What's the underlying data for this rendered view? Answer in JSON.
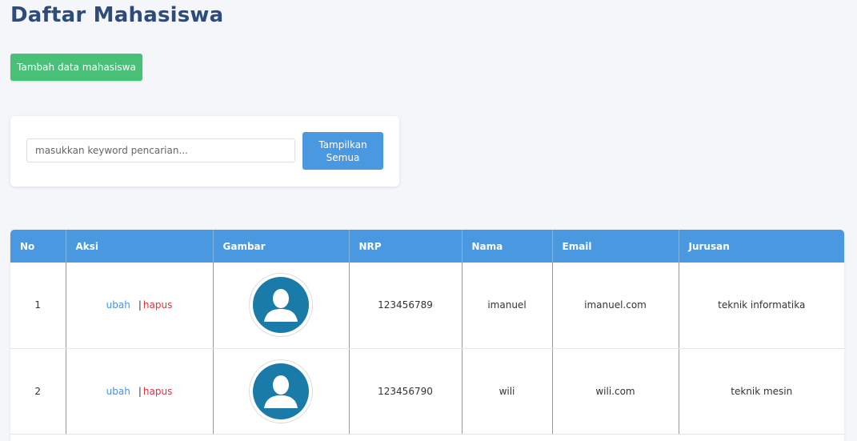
{
  "page": {
    "title": "Daftar Mahasiswa",
    "add_button_label": "Tambah data mahasiswa"
  },
  "search": {
    "placeholder": "masukkan keyword pencarian...",
    "value": "",
    "show_all_label": "Tampilkan Semua"
  },
  "table": {
    "headers": {
      "no": "No",
      "aksi": "Aksi",
      "gambar": "Gambar",
      "nrp": "NRP",
      "nama": "Nama",
      "email": "Email",
      "jurusan": "Jurusan"
    },
    "rows": [
      {
        "no": "1",
        "edit_label": "ubah",
        "separator": "|",
        "delete_label": "hapus",
        "image_icon": "user-avatar-icon",
        "nrp": "123456789",
        "nama": "imanuel",
        "email": "imanuel.com",
        "jurusan": "teknik informatika"
      },
      {
        "no": "2",
        "edit_label": "ubah",
        "separator": "|",
        "delete_label": "hapus",
        "image_icon": "user-avatar-icon",
        "nrp": "123456790",
        "nama": "wili",
        "email": "wili.com",
        "jurusan": "teknik mesin"
      }
    ]
  },
  "colors": {
    "title": "#2d4c7a",
    "add_button": "#48c078",
    "primary": "#4a98df",
    "edit_link": "#4a90d9",
    "delete_link": "#d9363e",
    "avatar": "#1a7aa8"
  }
}
